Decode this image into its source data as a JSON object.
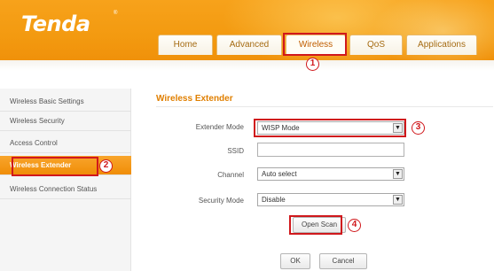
{
  "brand": {
    "logo_text": "Tenda",
    "trademark": "®"
  },
  "nav": {
    "tabs": [
      {
        "label": "Home"
      },
      {
        "label": "Advanced"
      },
      {
        "label": "Wireless"
      },
      {
        "label": "QoS"
      },
      {
        "label": "Applications"
      }
    ],
    "active_tab": "Wireless"
  },
  "sidebar": {
    "items": [
      {
        "label": "Wireless Basic Settings"
      },
      {
        "label": "Wireless Security"
      },
      {
        "label": "Access Control"
      },
      {
        "label": "Wireless Extender"
      },
      {
        "label": "Wireless Connection Status"
      }
    ],
    "active_item": "Wireless Extender"
  },
  "form": {
    "title": "Wireless Extender",
    "extender_mode": {
      "label": "Extender Mode",
      "value": "WISP Mode"
    },
    "ssid": {
      "label": "SSID",
      "value": ""
    },
    "channel": {
      "label": "Channel",
      "value": "Auto select"
    },
    "security_mode": {
      "label": "Security Mode",
      "value": "Disable"
    },
    "open_scan_label": "Open Scan",
    "ok_label": "OK",
    "cancel_label": "Cancel"
  },
  "annotations": {
    "markers": [
      "1",
      "2",
      "3",
      "4"
    ],
    "color": "#d0181c"
  },
  "colors": {
    "header_orange": "#f39a10",
    "accent_text": "#e07f00",
    "active_sidebar": "#f39a10"
  }
}
